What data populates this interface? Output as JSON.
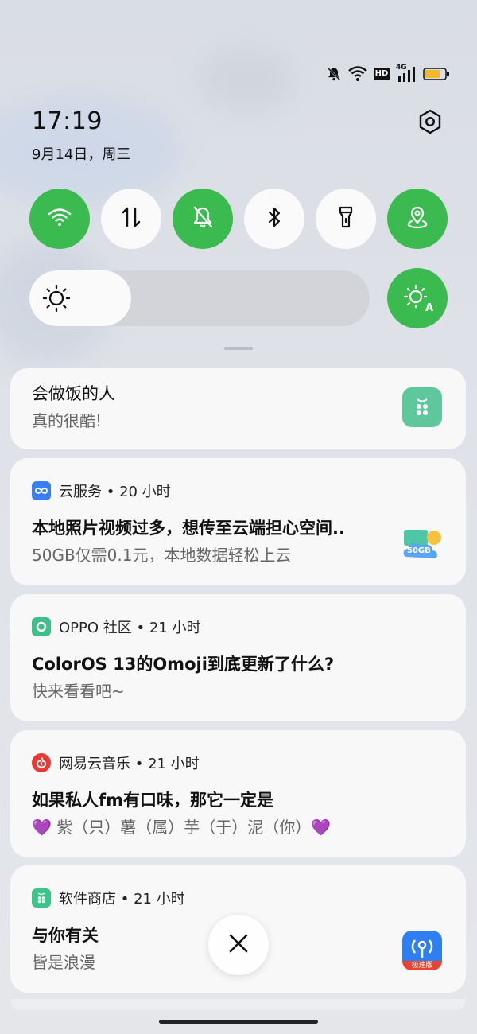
{
  "status": {
    "network": "4G",
    "hd": "HD",
    "icons": [
      "bell-off-icon",
      "wifi-icon",
      "hd-icon",
      "signal-icon",
      "battery-icon"
    ]
  },
  "clock": {
    "time": "17:19",
    "date": "9月14日，周三"
  },
  "quick_tiles": [
    {
      "name": "wifi",
      "icon": "wifi-icon",
      "on": true
    },
    {
      "name": "mobile-data",
      "icon": "data-arrows-icon",
      "on": false
    },
    {
      "name": "silent",
      "icon": "bell-off-icon",
      "on": true
    },
    {
      "name": "bluetooth",
      "icon": "bluetooth-icon",
      "on": false
    },
    {
      "name": "flashlight",
      "icon": "flashlight-icon",
      "on": false
    },
    {
      "name": "location",
      "icon": "location-icon",
      "on": true
    }
  ],
  "brightness": {
    "level": 0.3,
    "auto_label": "A"
  },
  "colors": {
    "accent_green": "#3bbb4f",
    "card_bg": "#f8f8f8"
  },
  "notifications": [
    {
      "title": "会做饭的人",
      "body": "真的很酷!"
    },
    {
      "app": "云服务",
      "time": "20 小时",
      "title": "本地照片视频过多，想传至云端担心空间..",
      "body": "50GB仅需0.1元，本地数据轻松上云",
      "thumb_text": "50GB"
    },
    {
      "app": "OPPO 社区",
      "time": "21 小时",
      "title": "ColorOS 13的Omoji到底更新了什么?",
      "body": "快来看看吧~"
    },
    {
      "app": "网易云音乐",
      "time": "21 小时",
      "title": "如果私人fm有口味，那它一定是",
      "body": "💜 紫（只）薯（属）芋（于）泥（你）💜"
    },
    {
      "app": "软件商店",
      "time": "21 小时",
      "title": "与你有关",
      "body": "皆是浪漫",
      "thumb_text": "极速版"
    }
  ],
  "separator": " • "
}
